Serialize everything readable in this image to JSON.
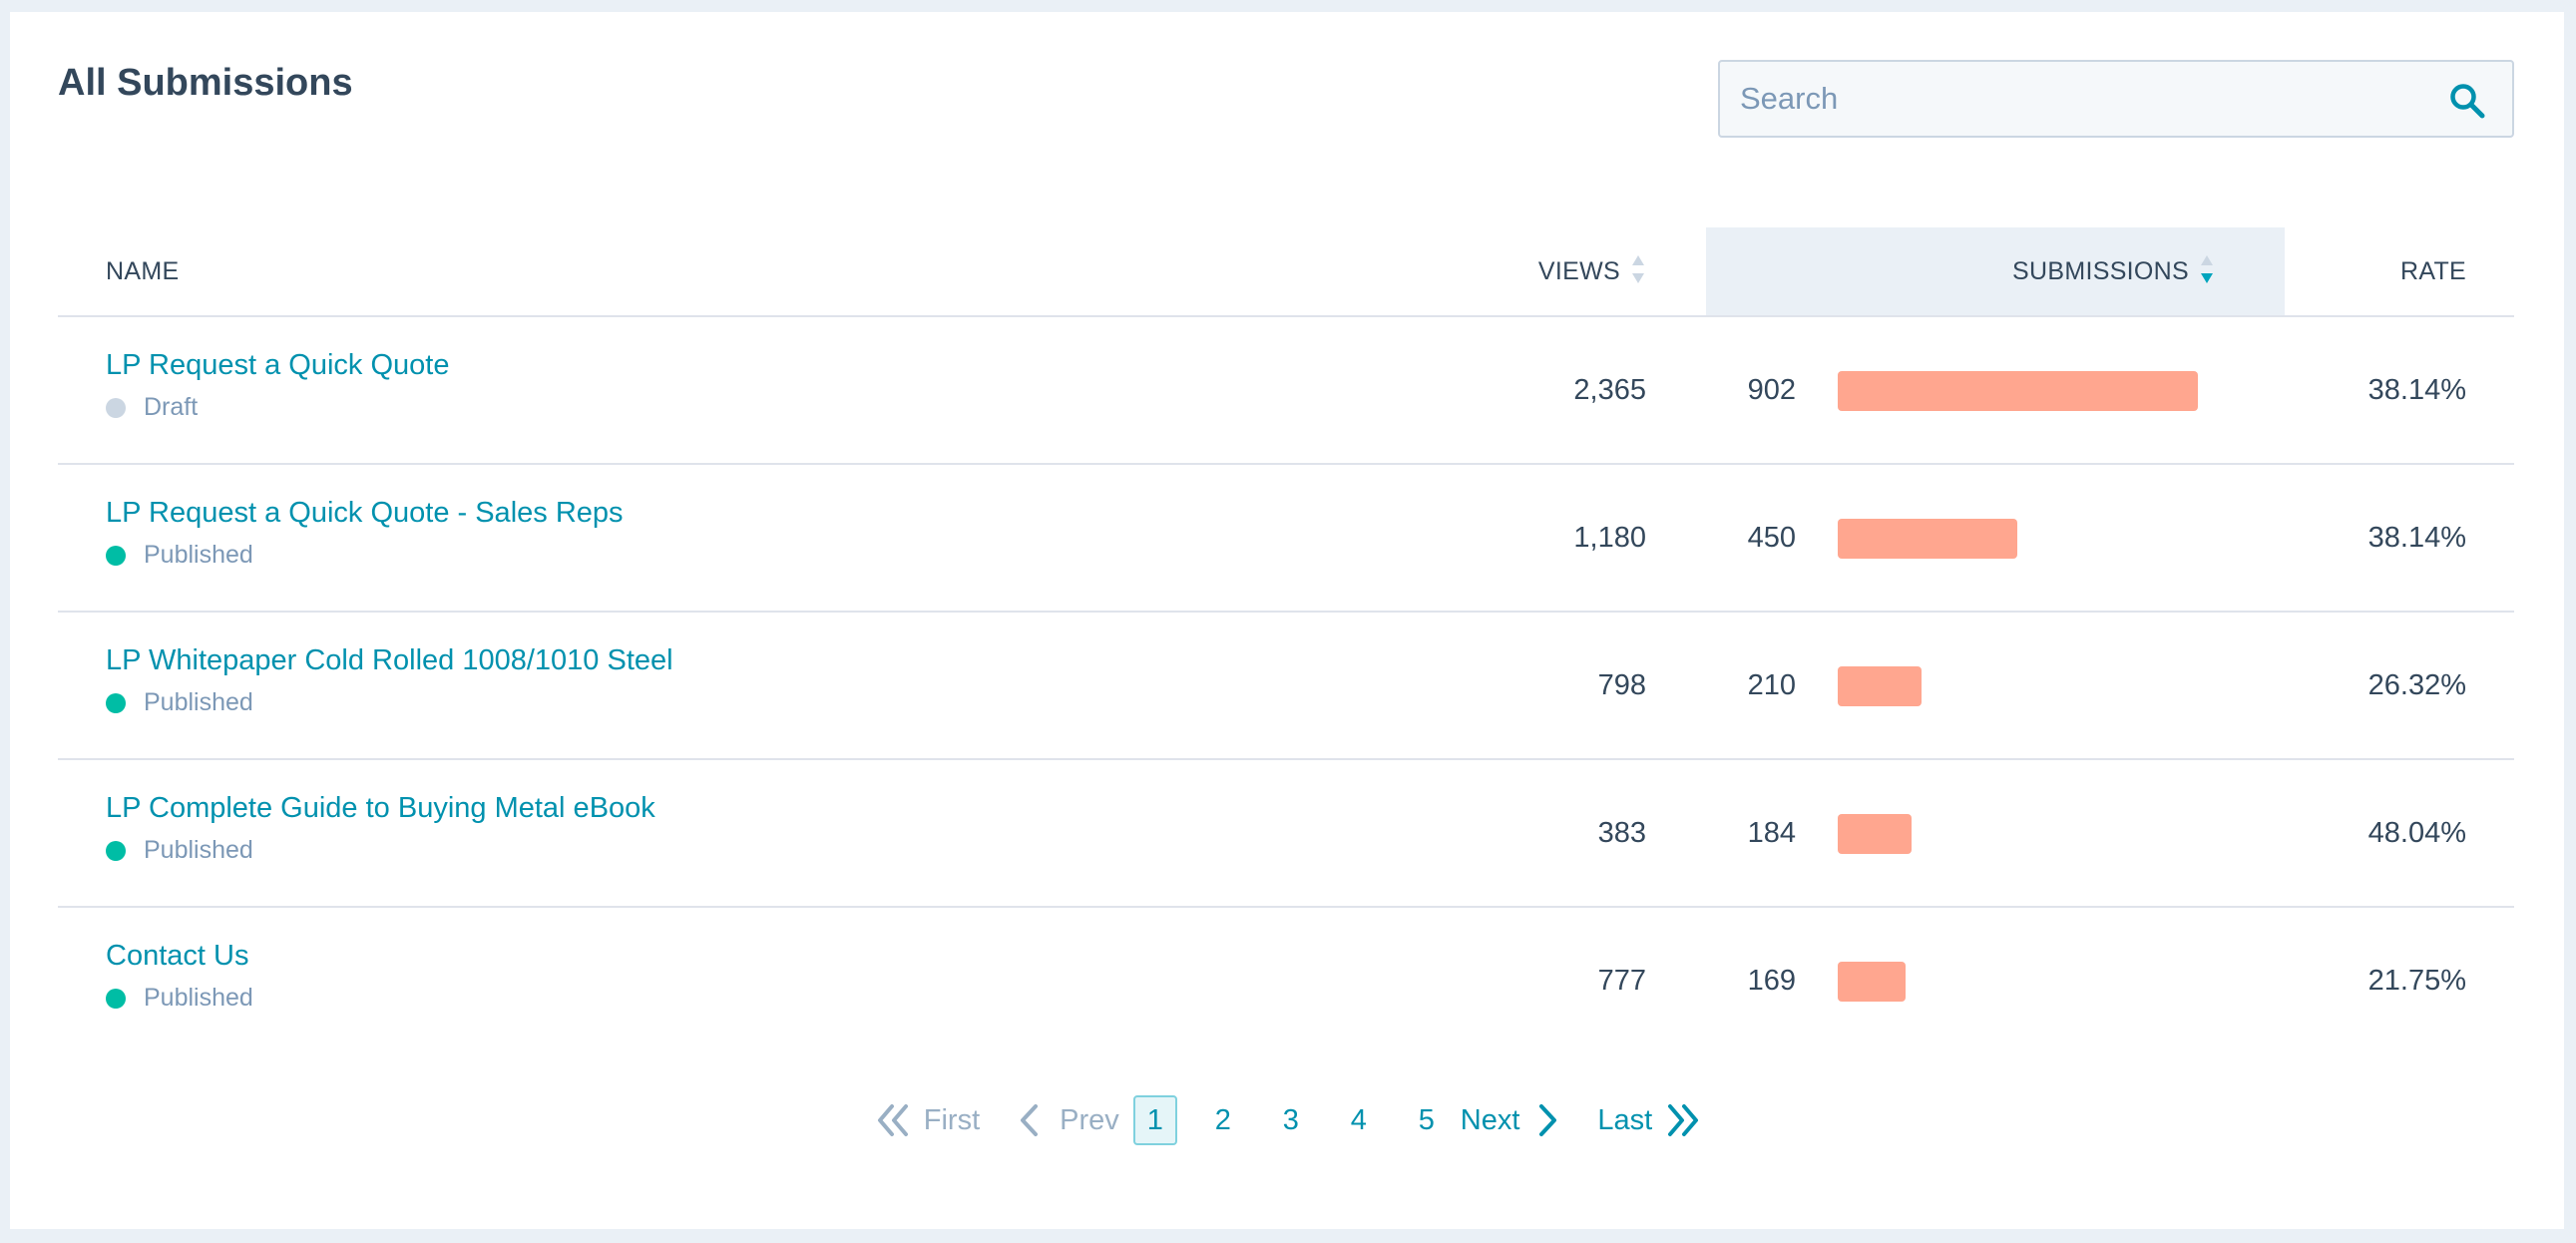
{
  "header": {
    "title": "All Submissions"
  },
  "search": {
    "placeholder": "Search"
  },
  "table": {
    "columns": {
      "name": "NAME",
      "views": "VIEWS",
      "submissions": "SUBMISSIONS",
      "rate": "RATE"
    },
    "sorted_column": "submissions",
    "sort_direction": "descending",
    "bar_scale_max": 1000,
    "rows": [
      {
        "name": "LP Request a Quick Quote",
        "status": "Draft",
        "views": "2,365",
        "submissions": "902",
        "submissions_value": 902,
        "rate": "38.14%"
      },
      {
        "name": "LP Request a Quick Quote - Sales Reps",
        "status": "Published",
        "views": "1,180",
        "submissions": "450",
        "submissions_value": 450,
        "rate": "38.14%"
      },
      {
        "name": "LP Whitepaper Cold Rolled 1008/1010 Steel",
        "status": "Published",
        "views": "798",
        "submissions": "210",
        "submissions_value": 210,
        "rate": "26.32%"
      },
      {
        "name": "LP Complete Guide to Buying Metal eBook",
        "status": "Published",
        "views": "383",
        "submissions": "184",
        "submissions_value": 184,
        "rate": "48.04%"
      },
      {
        "name": "Contact Us",
        "status": "Published",
        "views": "777",
        "submissions": "169",
        "submissions_value": 169,
        "rate": "21.75%"
      }
    ]
  },
  "pagination": {
    "first": "First",
    "prev": "Prev",
    "pages": [
      "1",
      "2",
      "3",
      "4",
      "5"
    ],
    "current": "1",
    "next": "Next",
    "last": "Last"
  },
  "colors": {
    "link": "#0091ae",
    "bar": "#ffa68f",
    "published_dot": "#00bda5",
    "draft_dot": "#cbd6e2",
    "header_highlight": "#eaf0f6"
  }
}
